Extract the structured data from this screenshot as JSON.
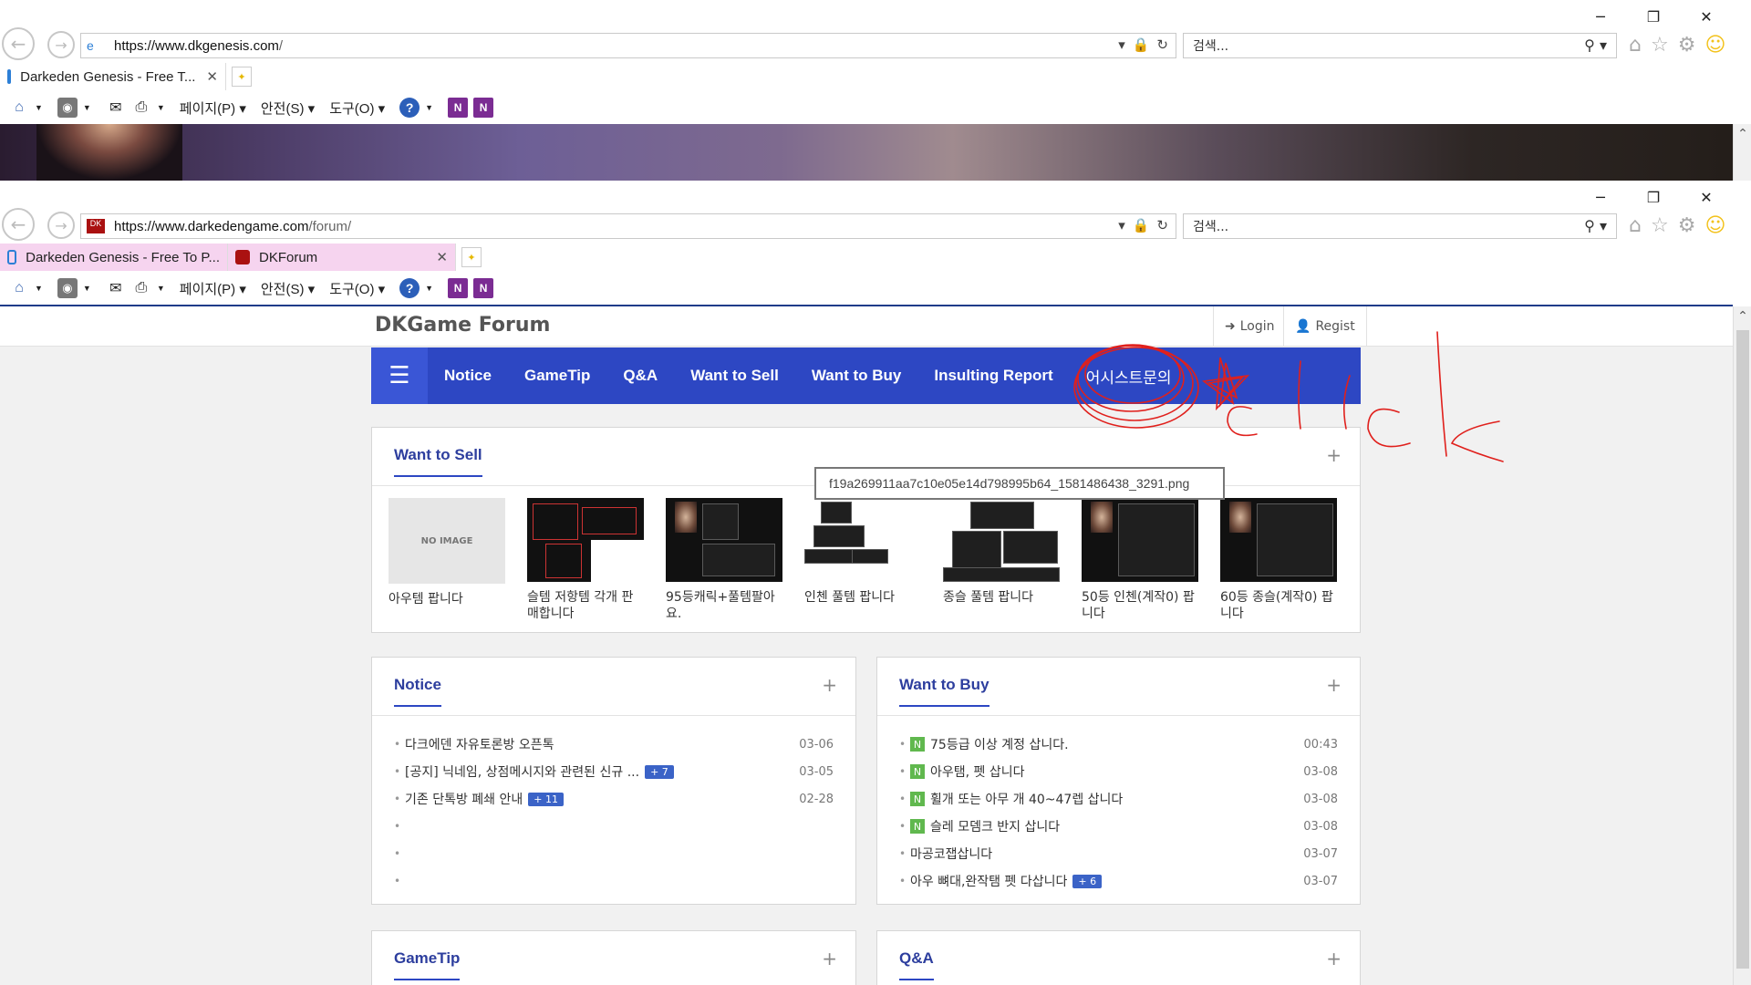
{
  "window1": {
    "url_host": "https://www.dkgenesis.com",
    "url_rest": "/",
    "search_placeholder": "검색...",
    "tabs": [
      {
        "label": "Darkeden Genesis - Free T..."
      }
    ]
  },
  "window2": {
    "url_host": "https://www.darkedengame.com",
    "url_rest": "/forum/",
    "search_placeholder": "검색...",
    "tabs": [
      {
        "label": "Darkeden Genesis - Free To P..."
      },
      {
        "label": "DKForum"
      }
    ]
  },
  "cmdbar": {
    "page": "페이지(P)",
    "safety": "안전(S)",
    "tools": "도구(O)"
  },
  "forum": {
    "brand": "DKGame Forum",
    "login": "Login",
    "regist": "Regist",
    "nav": [
      "Notice",
      "GameTip",
      "Q&A",
      "Want to Sell",
      "Want to Buy",
      "Insulting Report",
      "어시스트문의"
    ],
    "tooltip": "f19a269911aa7c10e05e14d798995b64_1581486438_3291.png",
    "sell": {
      "title": "Want to Sell",
      "no_image": "NO IMAGE",
      "items": [
        {
          "caption": "아우템 팝니다"
        },
        {
          "caption": "슬템 저항템 각개 판매합니다"
        },
        {
          "caption": "95등캐릭+풀템팔아요."
        },
        {
          "caption": "인첸 풀템 팝니다"
        },
        {
          "caption": "종슬 풀템 팝니다"
        },
        {
          "caption": "50등 인첸(계작0) 팝니다"
        },
        {
          "caption": "60등 종슬(계작0) 팝니다"
        }
      ]
    },
    "notice": {
      "title": "Notice",
      "items": [
        {
          "text": "다크에덴 자유토론방 오픈톡",
          "count": "",
          "date": "03-06"
        },
        {
          "text": "[공지] 닉네임, 상점메시지와 관련된 신규 ...",
          "count": "+ 7",
          "date": "03-05"
        },
        {
          "text": "기존 단톡방 폐쇄 안내",
          "count": "+ 11",
          "date": "02-28"
        },
        {
          "text": "",
          "count": "",
          "date": ""
        },
        {
          "text": "",
          "count": "",
          "date": ""
        },
        {
          "text": "",
          "count": "",
          "date": ""
        }
      ]
    },
    "buy": {
      "title": "Want to Buy",
      "new_badge": "N",
      "items": [
        {
          "text": "75등급 이상 계정 삽니다.",
          "count": "",
          "date": "00:43",
          "new": true
        },
        {
          "text": "아우탬, 펫 삽니다",
          "count": "",
          "date": "03-08",
          "new": true
        },
        {
          "text": "휠개 또는 아무 개 40~47렙 삽니다",
          "count": "",
          "date": "03-08",
          "new": true
        },
        {
          "text": "슬레 모뎀크 반지 삽니다",
          "count": "",
          "date": "03-08",
          "new": true
        },
        {
          "text": "마공코잽삽니다",
          "count": "",
          "date": "03-07",
          "new": false
        },
        {
          "text": "아우 뼈대,완작탬 펫 다삽니다",
          "count": "+ 6",
          "date": "03-07",
          "new": false
        }
      ]
    },
    "gametip": {
      "title": "GameTip"
    },
    "qa": {
      "title": "Q&A"
    }
  },
  "annotation": {
    "text": "click",
    "color": "#e0201c"
  },
  "colors": {
    "nav_bg": "#2d47c3",
    "title": "#2d3e9e",
    "new_badge": "#60b84e",
    "count_badge": "#3b63c7"
  }
}
